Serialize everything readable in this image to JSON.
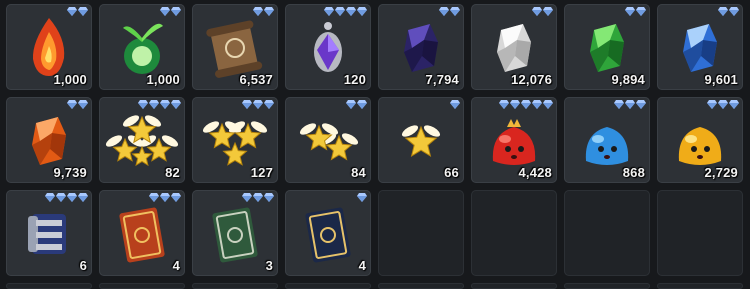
{
  "inventory": {
    "slots": [
      {
        "name": "fire-crystal",
        "icon": "fire-crystal-icon",
        "quantity": "1,000",
        "rarity": 2
      },
      {
        "name": "green-sprout-orb",
        "icon": "sprout-orb-icon",
        "quantity": "1,000",
        "rarity": 2
      },
      {
        "name": "ancient-scroll",
        "icon": "scroll-icon",
        "quantity": "6,537",
        "rarity": 2
      },
      {
        "name": "purple-pendant",
        "icon": "pendant-icon",
        "quantity": "120",
        "rarity": 4
      },
      {
        "name": "purple-crystal",
        "icon": "purple-crystal-icon",
        "quantity": "7,794",
        "rarity": 2
      },
      {
        "name": "white-crystal",
        "icon": "white-crystal-icon",
        "quantity": "12,076",
        "rarity": 2
      },
      {
        "name": "green-crystal",
        "icon": "green-crystal-icon",
        "quantity": "9,894",
        "rarity": 2
      },
      {
        "name": "blue-crystal",
        "icon": "blue-crystal-icon",
        "quantity": "9,601",
        "rarity": 2
      },
      {
        "name": "orange-crystal",
        "icon": "orange-crystal-icon",
        "quantity": "9,739",
        "rarity": 2
      },
      {
        "name": "winged-stars-large",
        "icon": "winged-stars-icon",
        "quantity": "82",
        "rarity": 4
      },
      {
        "name": "winged-stars-medium",
        "icon": "winged-stars-icon",
        "quantity": "127",
        "rarity": 3
      },
      {
        "name": "winged-stars-small",
        "icon": "winged-stars-icon",
        "quantity": "84",
        "rarity": 2
      },
      {
        "name": "winged-star",
        "icon": "winged-star-icon",
        "quantity": "66",
        "rarity": 1
      },
      {
        "name": "red-slime",
        "icon": "red-slime-icon",
        "quantity": "4,428",
        "rarity": 5
      },
      {
        "name": "blue-slime",
        "icon": "blue-slime-icon",
        "quantity": "868",
        "rarity": 3
      },
      {
        "name": "gold-slime",
        "icon": "gold-slime-icon",
        "quantity": "2,729",
        "rarity": 3
      },
      {
        "name": "armored-gauntlet",
        "icon": "gauntlet-icon",
        "quantity": "6",
        "rarity": 4
      },
      {
        "name": "red-tome",
        "icon": "red-book-icon",
        "quantity": "4",
        "rarity": 3
      },
      {
        "name": "green-tome",
        "icon": "green-book-icon",
        "quantity": "3",
        "rarity": 3
      },
      {
        "name": "navy-tome",
        "icon": "navy-book-icon",
        "quantity": "4",
        "rarity": 1
      },
      {
        "name": "empty"
      },
      {
        "name": "empty"
      },
      {
        "name": "empty"
      },
      {
        "name": "empty"
      },
      {
        "name": "empty-partial"
      },
      {
        "name": "empty-partial"
      },
      {
        "name": "empty-partial"
      },
      {
        "name": "empty-partial"
      },
      {
        "name": "empty-partial"
      },
      {
        "name": "empty-partial"
      },
      {
        "name": "empty-partial"
      },
      {
        "name": "empty-partial"
      }
    ]
  },
  "colors": {
    "gem": "#a9c9ff",
    "gem_shade": "#6f9be0",
    "slot_bg": "#2d3136",
    "page_bg": "#17191c"
  }
}
